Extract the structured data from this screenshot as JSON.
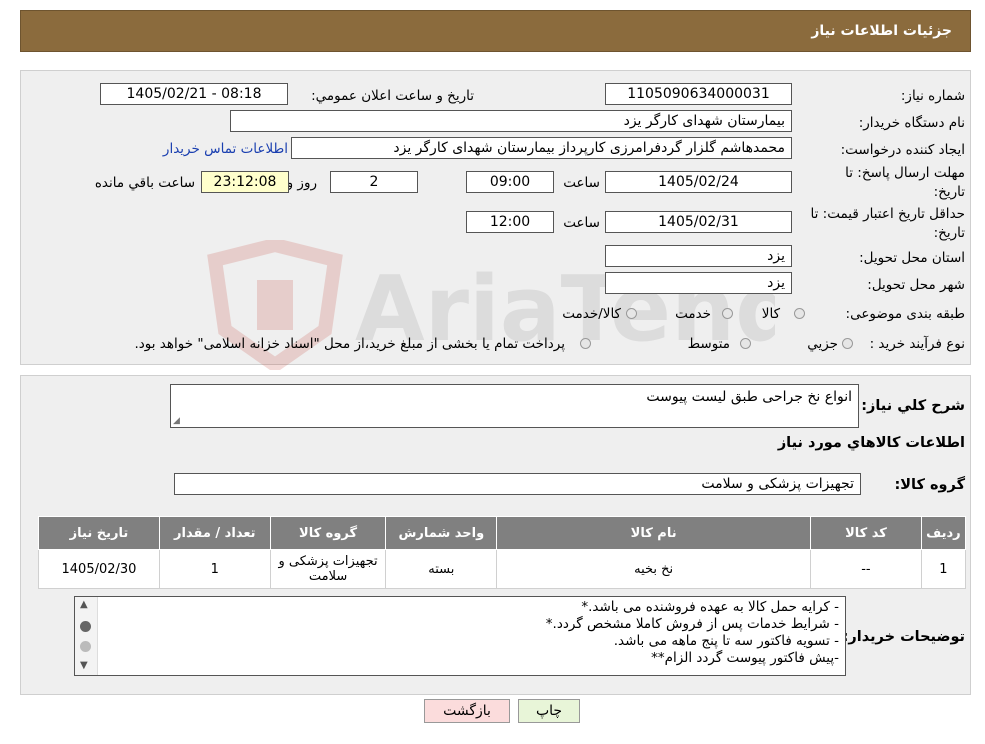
{
  "header": {
    "title": "جزئيات اطلاعات نياز"
  },
  "form": {
    "need_number_label": "شماره نياز:",
    "need_number": "1105090634000031",
    "announce_label": "تاريخ و ساعت اعلان عمومي:",
    "announce_value": "1405/02/21 - 08:18",
    "buyer_label": "نام دستگاه خريدار:",
    "buyer_value": "بيمارستان شهداى كارگر يزد",
    "creator_label": "ايجاد كننده درخواست:",
    "creator_value": "محمدهاشم گلزار گردفرامرزی کارپرداز بیمارستان شهدای کارگر یزد",
    "contact_link": "اطلاعات تماس خريدار",
    "reply_label_1": "مهلت ارسال پاسخ: تا",
    "reply_label_2": "تاريخ:",
    "reply_date": "1405/02/24",
    "time_label": "ساعت",
    "reply_time": "09:00",
    "days_value": "2",
    "days_label": "روز و",
    "remaining_value": "23:12:08",
    "remaining_label": "ساعت باقي مانده",
    "validity_label_1": "حداقل تاريخ اعتبار قيمت: تا",
    "validity_label_2": "تاريخ:",
    "validity_date": "1405/02/31",
    "validity_time": "12:00",
    "province_label": "استان محل تحويل:",
    "province_value": "يزد",
    "city_label": "شهر محل تحويل:",
    "city_value": "يزد",
    "category_label": "طبقه بندی موضوعی:",
    "category_options": [
      "كالا",
      "خدمت",
      "كالا/خدمت"
    ],
    "process_label": "نوع فرآيند خريد :",
    "process_options": [
      "جزيي",
      "متوسط"
    ],
    "process_note": "پرداخت تمام يا بخشی از مبلغ خريد،از محل \"اسناد خزانه اسلامی\" خواهد بود."
  },
  "details": {
    "summary_label": "شرح كلي نياز:",
    "summary_value": "انواع نخ جراحی طبق لیست پیوست",
    "goods_info_title": "اطلاعات كالاهاي مورد نياز",
    "goods_group_label": "گروه كالا:",
    "goods_group_value": "تجهيزات پزشكی و سلامت",
    "table": {
      "headers": [
        "رديف",
        "كد كالا",
        "نام كالا",
        "واحد شمارش",
        "گروه كالا",
        "تعداد / مقدار",
        "تاريخ نياز"
      ],
      "rows": [
        [
          "1",
          "--",
          "نخ بخیه",
          "بسته",
          "تجهيزات پزشكی و سلامت",
          "1",
          "1405/02/30"
        ]
      ]
    },
    "notes_label": "توضيحات خريدار:",
    "notes_lines": [
      "- کرایه حمل  کالا به عهده فروشنده می باشد.*",
      "- شرایط خدمات پس از فروش کاملا مشخص گردد.*",
      "- تسویه فاکتور سه تا پنج ماهه می باشد.",
      "-پیش فاکتور پیوست گردد  الزام**"
    ]
  },
  "buttons": {
    "print": "چاپ",
    "back": "بازگشت"
  },
  "colors": {
    "header": "#8b6b3d",
    "table_header": "#808080",
    "highlight": "#ffffcc",
    "link": "#1a3fb0"
  }
}
